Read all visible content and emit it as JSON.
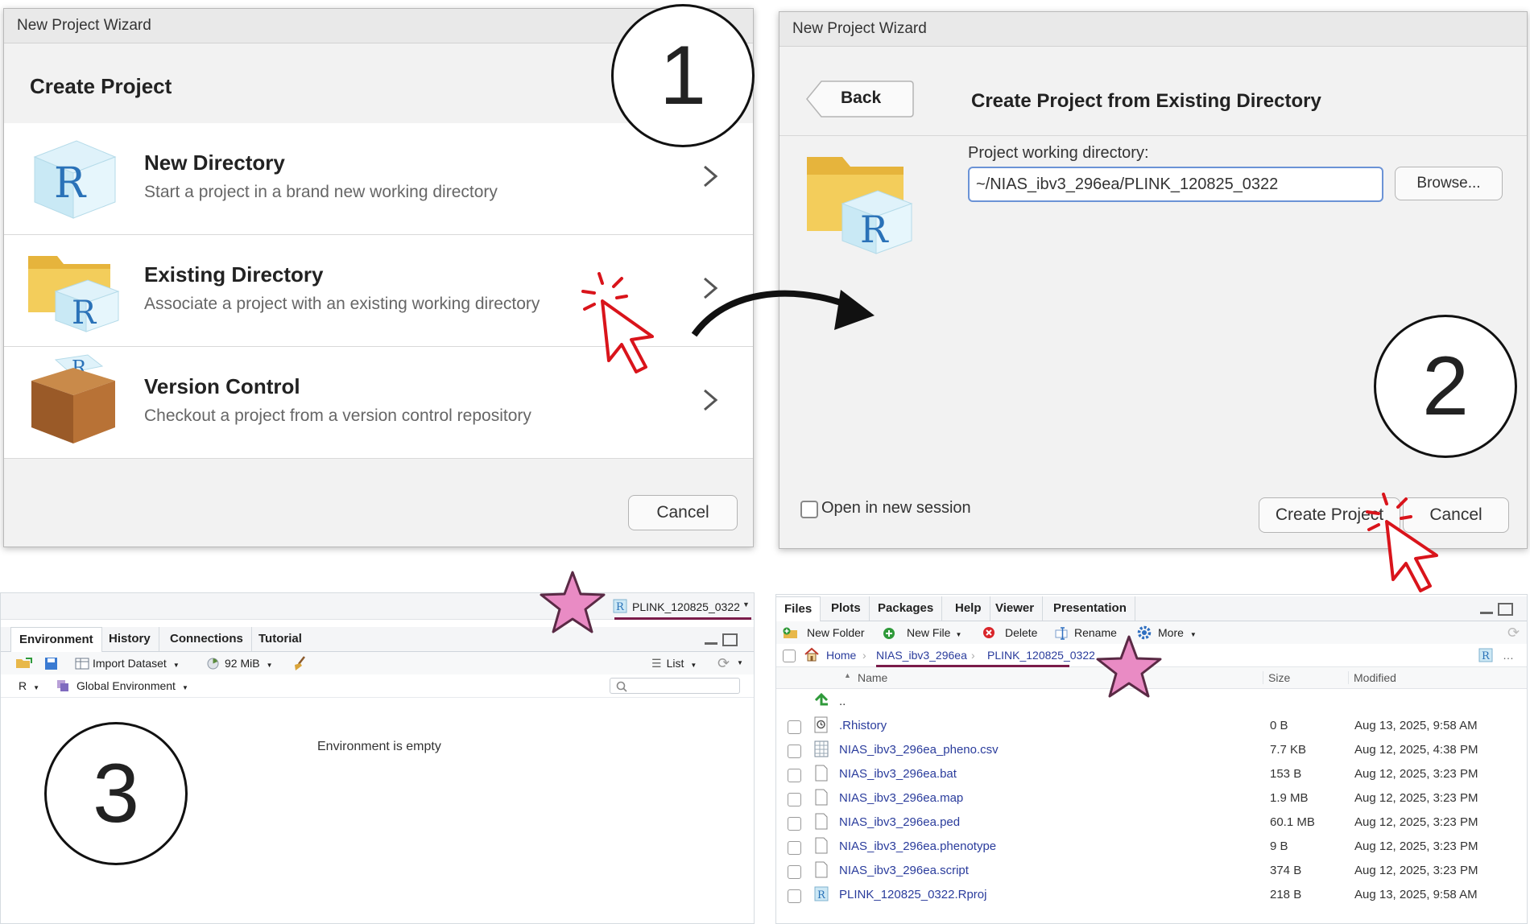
{
  "wizard1": {
    "title": "New Project Wizard",
    "header": "Create Project",
    "options": [
      {
        "title": "New Directory",
        "desc": "Start a project in a brand new working directory",
        "icon": "r-cube-icon"
      },
      {
        "title": "Existing Directory",
        "desc": "Associate a project with an existing working directory",
        "icon": "folder-r-icon"
      },
      {
        "title": "Version Control",
        "desc": "Checkout a project from a version control repository",
        "icon": "box-r-icon"
      }
    ],
    "cancel": "Cancel"
  },
  "wizard2": {
    "title": "New Project Wizard",
    "back": "Back",
    "header": "Create Project from Existing Directory",
    "dir_label": "Project working directory:",
    "dir_value": "~/NIAS_ibv3_296ea/PLINK_120825_0322",
    "browse": "Browse...",
    "open_new_session": "Open in new session",
    "create": "Create Project",
    "cancel": "Cancel"
  },
  "steps": {
    "one": "1",
    "two": "2",
    "three": "3"
  },
  "env_pane": {
    "project_name": "PLINK_120825_0322",
    "tabs": [
      "Environment",
      "History",
      "Connections",
      "Tutorial"
    ],
    "import_dataset": "Import Dataset",
    "memory": "92 MiB",
    "list_label": "List",
    "r_label": "R",
    "global_env": "Global Environment",
    "empty_msg": "Environment is empty"
  },
  "files_pane": {
    "tabs": [
      "Files",
      "Plots",
      "Packages",
      "Help",
      "Viewer",
      "Presentation"
    ],
    "new_folder": "New Folder",
    "new_file": "New File",
    "delete": "Delete",
    "rename": "Rename",
    "more": "More",
    "breadcrumb": [
      "Home",
      "NIAS_ibv3_296ea",
      "PLINK_120825_0322"
    ],
    "columns": {
      "name": "Name",
      "size": "Size",
      "modified": "Modified"
    },
    "up": "..",
    "files": [
      {
        "name": ".Rhistory",
        "size": "0 B",
        "modified": "Aug 13, 2025, 9:58 AM",
        "icon": "history-file-icon"
      },
      {
        "name": "NIAS_ibv3_296ea_pheno.csv",
        "size": "7.7 KB",
        "modified": "Aug 12, 2025, 4:38 PM",
        "icon": "csv-file-icon"
      },
      {
        "name": "NIAS_ibv3_296ea.bat",
        "size": "153 B",
        "modified": "Aug 12, 2025, 3:23 PM",
        "icon": "file-icon"
      },
      {
        "name": "NIAS_ibv3_296ea.map",
        "size": "1.9 MB",
        "modified": "Aug 12, 2025, 3:23 PM",
        "icon": "file-icon"
      },
      {
        "name": "NIAS_ibv3_296ea.ped",
        "size": "60.1 MB",
        "modified": "Aug 12, 2025, 3:23 PM",
        "icon": "file-icon"
      },
      {
        "name": "NIAS_ibv3_296ea.phenotype",
        "size": "9 B",
        "modified": "Aug 12, 2025, 3:23 PM",
        "icon": "file-icon"
      },
      {
        "name": "NIAS_ibv3_296ea.script",
        "size": "374 B",
        "modified": "Aug 12, 2025, 3:23 PM",
        "icon": "file-icon"
      },
      {
        "name": "PLINK_120825_0322.Rproj",
        "size": "218 B",
        "modified": "Aug 13, 2025, 9:58 AM",
        "icon": "rproj-file-icon"
      }
    ]
  },
  "colors": {
    "accent_red": "#d9141b",
    "star_pink": "#e98bc4",
    "underline": "#7a1c4a",
    "link": "#2a3c9c"
  }
}
